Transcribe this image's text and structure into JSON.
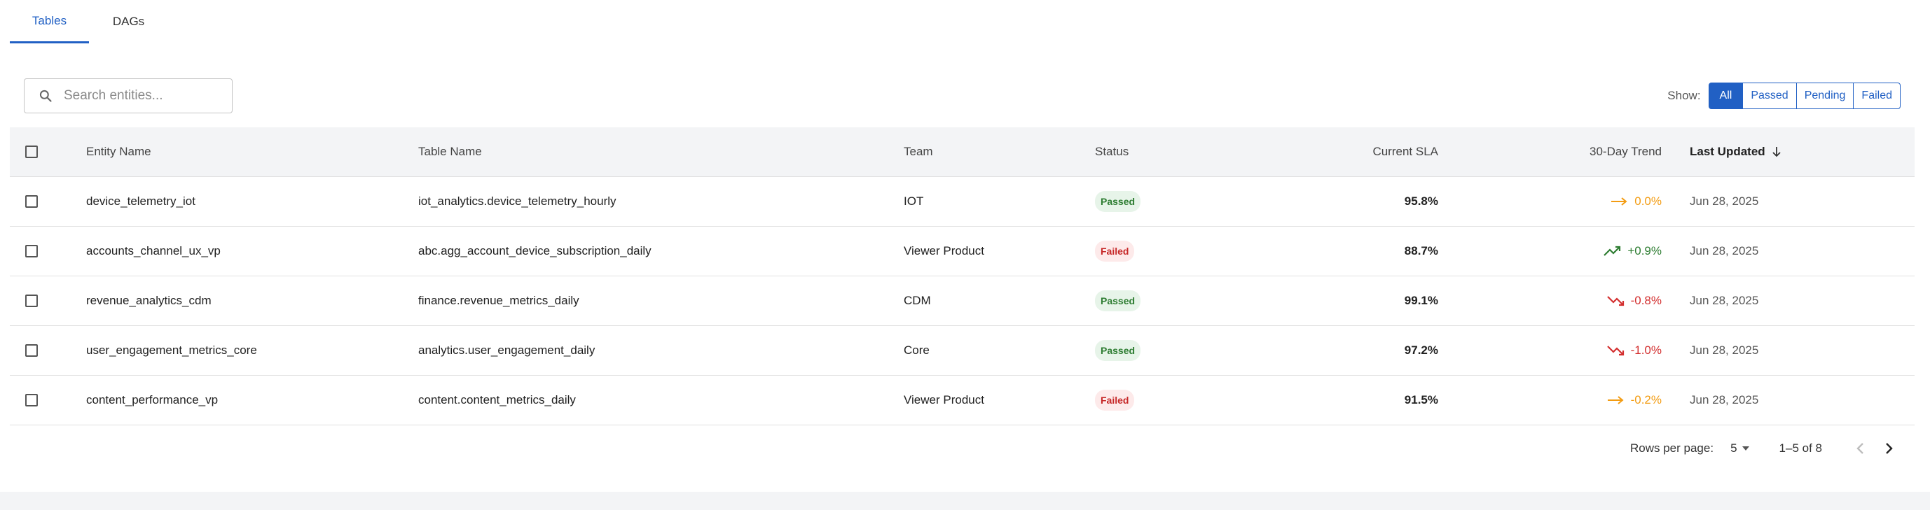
{
  "tabs": [
    {
      "label": "Tables"
    },
    {
      "label": "DAGs"
    }
  ],
  "search": {
    "placeholder": "Search entities..."
  },
  "filter": {
    "label": "Show:",
    "options": [
      "All",
      "Passed",
      "Pending",
      "Failed"
    ],
    "selected": "All"
  },
  "table": {
    "headers": {
      "entity": "Entity Name",
      "table": "Table Name",
      "team": "Team",
      "status": "Status",
      "sla": "Current SLA",
      "trend": "30-Day Trend",
      "updated": "Last Updated"
    },
    "sort": {
      "column": "Last Updated",
      "direction": "descending"
    },
    "rows": [
      {
        "entity": "device_telemetry_iot",
        "table": "iot_analytics.device_telemetry_hourly",
        "team": "IOT",
        "status": "Passed",
        "sla": "95.8%",
        "trend": "0.0%",
        "trend_dir": "flat",
        "updated": "Jun 28, 2025"
      },
      {
        "entity": "accounts_channel_ux_vp",
        "table": "abc.agg_account_device_subscription_daily",
        "team": "Viewer Product",
        "status": "Failed",
        "sla": "88.7%",
        "trend": "+0.9%",
        "trend_dir": "up",
        "updated": "Jun 28, 2025"
      },
      {
        "entity": "revenue_analytics_cdm",
        "table": "finance.revenue_metrics_daily",
        "team": "CDM",
        "status": "Passed",
        "sla": "99.1%",
        "trend": "-0.8%",
        "trend_dir": "down",
        "updated": "Jun 28, 2025"
      },
      {
        "entity": "user_engagement_metrics_core",
        "table": "analytics.user_engagement_daily",
        "team": "Core",
        "status": "Passed",
        "sla": "97.2%",
        "trend": "-1.0%",
        "trend_dir": "down",
        "updated": "Jun 28, 2025"
      },
      {
        "entity": "content_performance_vp",
        "table": "content.content_metrics_daily",
        "team": "Viewer Product",
        "status": "Failed",
        "sla": "91.5%",
        "trend": "-0.2%",
        "trend_dir": "flat",
        "updated": "Jun 28, 2025"
      }
    ]
  },
  "pagination": {
    "rows_label": "Rows per page:",
    "rows_value": "5",
    "range": "1–5 of 8"
  },
  "colors": {
    "accent": "#2160c4",
    "passed_bg": "#e7f4e9",
    "passed_fg": "#2e7d32",
    "failed_bg": "#fdeaea",
    "failed_fg": "#c62828",
    "trend_up": "#2e7d32",
    "trend_down": "#d32f2f",
    "trend_flat": "#f39c12"
  }
}
